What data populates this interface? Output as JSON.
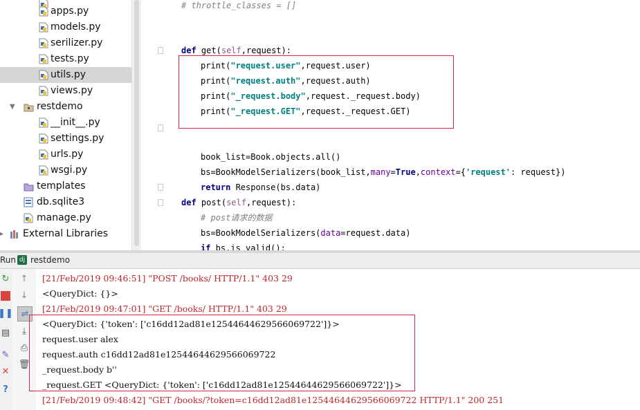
{
  "project_tree": {
    "items": [
      {
        "label": "apps.py",
        "type": "py"
      },
      {
        "label": "models.py",
        "type": "py"
      },
      {
        "label": "serilizer.py",
        "type": "py"
      },
      {
        "label": "tests.py",
        "type": "py"
      },
      {
        "label": "utils.py",
        "type": "py",
        "selected": true
      },
      {
        "label": "views.py",
        "type": "py"
      },
      {
        "label": "restdemo",
        "type": "package"
      },
      {
        "label": "__init__.py",
        "type": "py"
      },
      {
        "label": "settings.py",
        "type": "py"
      },
      {
        "label": "urls.py",
        "type": "py"
      },
      {
        "label": "wsgi.py",
        "type": "py"
      },
      {
        "label": "templates",
        "type": "folder"
      },
      {
        "label": "db.sqlite3",
        "type": "db"
      },
      {
        "label": "manage.py",
        "type": "py"
      },
      {
        "label": "External Libraries",
        "type": "lib"
      }
    ]
  },
  "editor": {
    "line_throttle": "# throttle_classes = []",
    "def_get": {
      "kw": "def",
      "name": "get",
      "self": "self",
      "rest": ",request):"
    },
    "prints": [
      {
        "fn": "print(",
        "str": "\"request.user\"",
        "rest": ",request.user)"
      },
      {
        "fn": "print(",
        "str": "\"request.auth\"",
        "rest": ",request.auth)"
      },
      {
        "fn": "print(",
        "str": "\"_request.body\"",
        "rest": ",request._request.body)"
      },
      {
        "fn": "print(",
        "str": "\"_request.GET\"",
        "rest": ",request._request.GET)"
      }
    ],
    "book_list": "book_list=Book.objects.all()",
    "bs_line": {
      "pre": "bs=BookModelSerializers(book_list,",
      "p1": "many",
      "eq1": "=",
      "v1": "True",
      "comma": ",",
      "p2": "context",
      "eq2": "={",
      "s": "'request'",
      "rest": ": request})"
    },
    "return_line": {
      "kw": "return",
      "rest": " Response(bs.data)"
    },
    "def_post": {
      "kw": "def",
      "name": "post",
      "self": "self",
      "rest": ",request):"
    },
    "post_comment": "# post请求的数据",
    "bs_post": {
      "pre": "bs=BookModelSerializers(",
      "p": "data",
      "rest": "=request.data)"
    },
    "if_line": {
      "kw": "if",
      "rest": " bs.is_valid():"
    }
  },
  "run_bar": {
    "label": "Run",
    "config": "restdemo"
  },
  "console": {
    "lines": [
      {
        "text": "[21/Feb/2019 09:46:51] \"POST /books/ HTTP/1.1\" 403 29",
        "kind": "err"
      },
      {
        "text": "<QueryDict: {}>",
        "kind": "norm"
      },
      {
        "text": "[21/Feb/2019 09:47:01] \"GET /books/ HTTP/1.1\" 403 29",
        "kind": "err"
      },
      {
        "text": "<QueryDict: {'token': ['c16dd12ad81e12544644629566069722']}>",
        "kind": "norm"
      },
      {
        "text": "request.user alex",
        "kind": "norm"
      },
      {
        "text": "request.auth c16dd12ad81e12544644629566069722",
        "kind": "norm"
      },
      {
        "text": "_request.body b''",
        "kind": "norm"
      },
      {
        "text": "_request.GET <QueryDict: {'token': ['c16dd12ad81e12544644629566069722']}>",
        "kind": "norm"
      },
      {
        "text": "[21/Feb/2019 09:48:42] \"GET /books/?token=c16dd12ad81e12544644629566069722 HTTP/1.1\" 200 251",
        "kind": "err"
      }
    ]
  },
  "colors": {
    "error_text": "#c0252b",
    "keyword": "#000080",
    "string": "#008080",
    "highlight_box": "#d7263d"
  }
}
